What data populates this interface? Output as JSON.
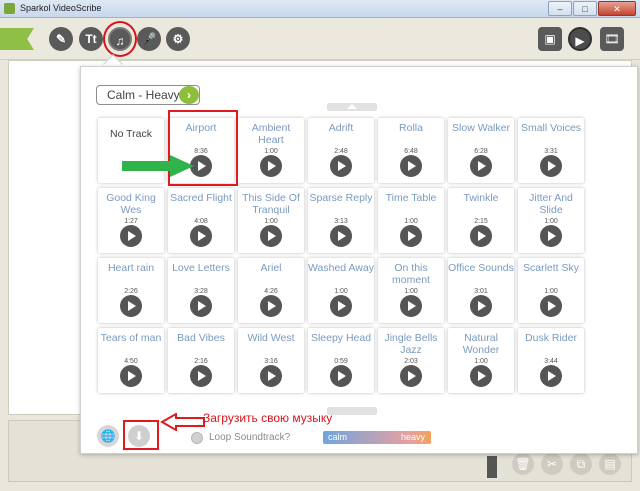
{
  "window": {
    "title": "Sparkol VideoScribe",
    "minimize": "–",
    "maximize": "□",
    "close": "✕"
  },
  "toolbar": {
    "tools": [
      {
        "id": "pen",
        "glyph": "✎"
      },
      {
        "id": "text",
        "glyph": "Tt"
      },
      {
        "id": "music",
        "glyph": "♫"
      },
      {
        "id": "voice",
        "glyph": "🎤"
      },
      {
        "id": "settings",
        "glyph": "⚙"
      }
    ],
    "right": [
      {
        "id": "image",
        "glyph": "▣"
      },
      {
        "id": "play",
        "glyph": "▶"
      },
      {
        "id": "film",
        "glyph": "🎞"
      }
    ]
  },
  "popup": {
    "genre": "Calm - Heavy",
    "genre_arrow": "›",
    "tracks": [
      {
        "name": "No Track",
        "duration": ""
      },
      {
        "name": "Airport",
        "duration": "8:36"
      },
      {
        "name": "Ambient Heart",
        "duration": "1:00"
      },
      {
        "name": "Adrift",
        "duration": "2:48"
      },
      {
        "name": "Rolla",
        "duration": "6:48"
      },
      {
        "name": "Slow Walker",
        "duration": "6:28"
      },
      {
        "name": "Small Voices",
        "duration": "3:31"
      },
      {
        "name": "Good King Wes",
        "duration": "1:27"
      },
      {
        "name": "Sacred Flight",
        "duration": "4:08"
      },
      {
        "name": "This Side Of Tranquil",
        "duration": "1:00"
      },
      {
        "name": "Sparse Reply",
        "duration": "3:13"
      },
      {
        "name": "Time Table",
        "duration": "1:00"
      },
      {
        "name": "Twinkle",
        "duration": "2:15"
      },
      {
        "name": "Jitter And Slide",
        "duration": "1:00"
      },
      {
        "name": "Heart rain",
        "duration": "2:26"
      },
      {
        "name": "Love Letters",
        "duration": "3:28"
      },
      {
        "name": "Ariel",
        "duration": "4:26"
      },
      {
        "name": "Washed Away",
        "duration": "1:00"
      },
      {
        "name": "On this moment",
        "duration": "1:00"
      },
      {
        "name": "Office Sounds",
        "duration": "3:01"
      },
      {
        "name": "Scarlett Sky",
        "duration": "1:00"
      },
      {
        "name": "Tears of man",
        "duration": "4:50"
      },
      {
        "name": "Bad Vibes",
        "duration": "2:16"
      },
      {
        "name": "Wild West",
        "duration": "3:16"
      },
      {
        "name": "Sleepy Head",
        "duration": "0:59"
      },
      {
        "name": "Jingle Bells Jazz",
        "duration": "2:03"
      },
      {
        "name": "Natural Wonder",
        "duration": "1:00"
      },
      {
        "name": "Dusk Rider",
        "duration": "3:44"
      }
    ],
    "loop_label": "Loop Soundtrack?",
    "mood_calm": "calm",
    "mood_heavy": "heavy",
    "globe_glyph": "🌐",
    "upload_glyph": "⬇"
  },
  "annotation": {
    "upload_text": "Загрузить свою музыку"
  },
  "colors": {
    "accent_green": "#8dbf3c",
    "annotation_red": "#e01b20",
    "track_text": "#7a9ac0"
  }
}
